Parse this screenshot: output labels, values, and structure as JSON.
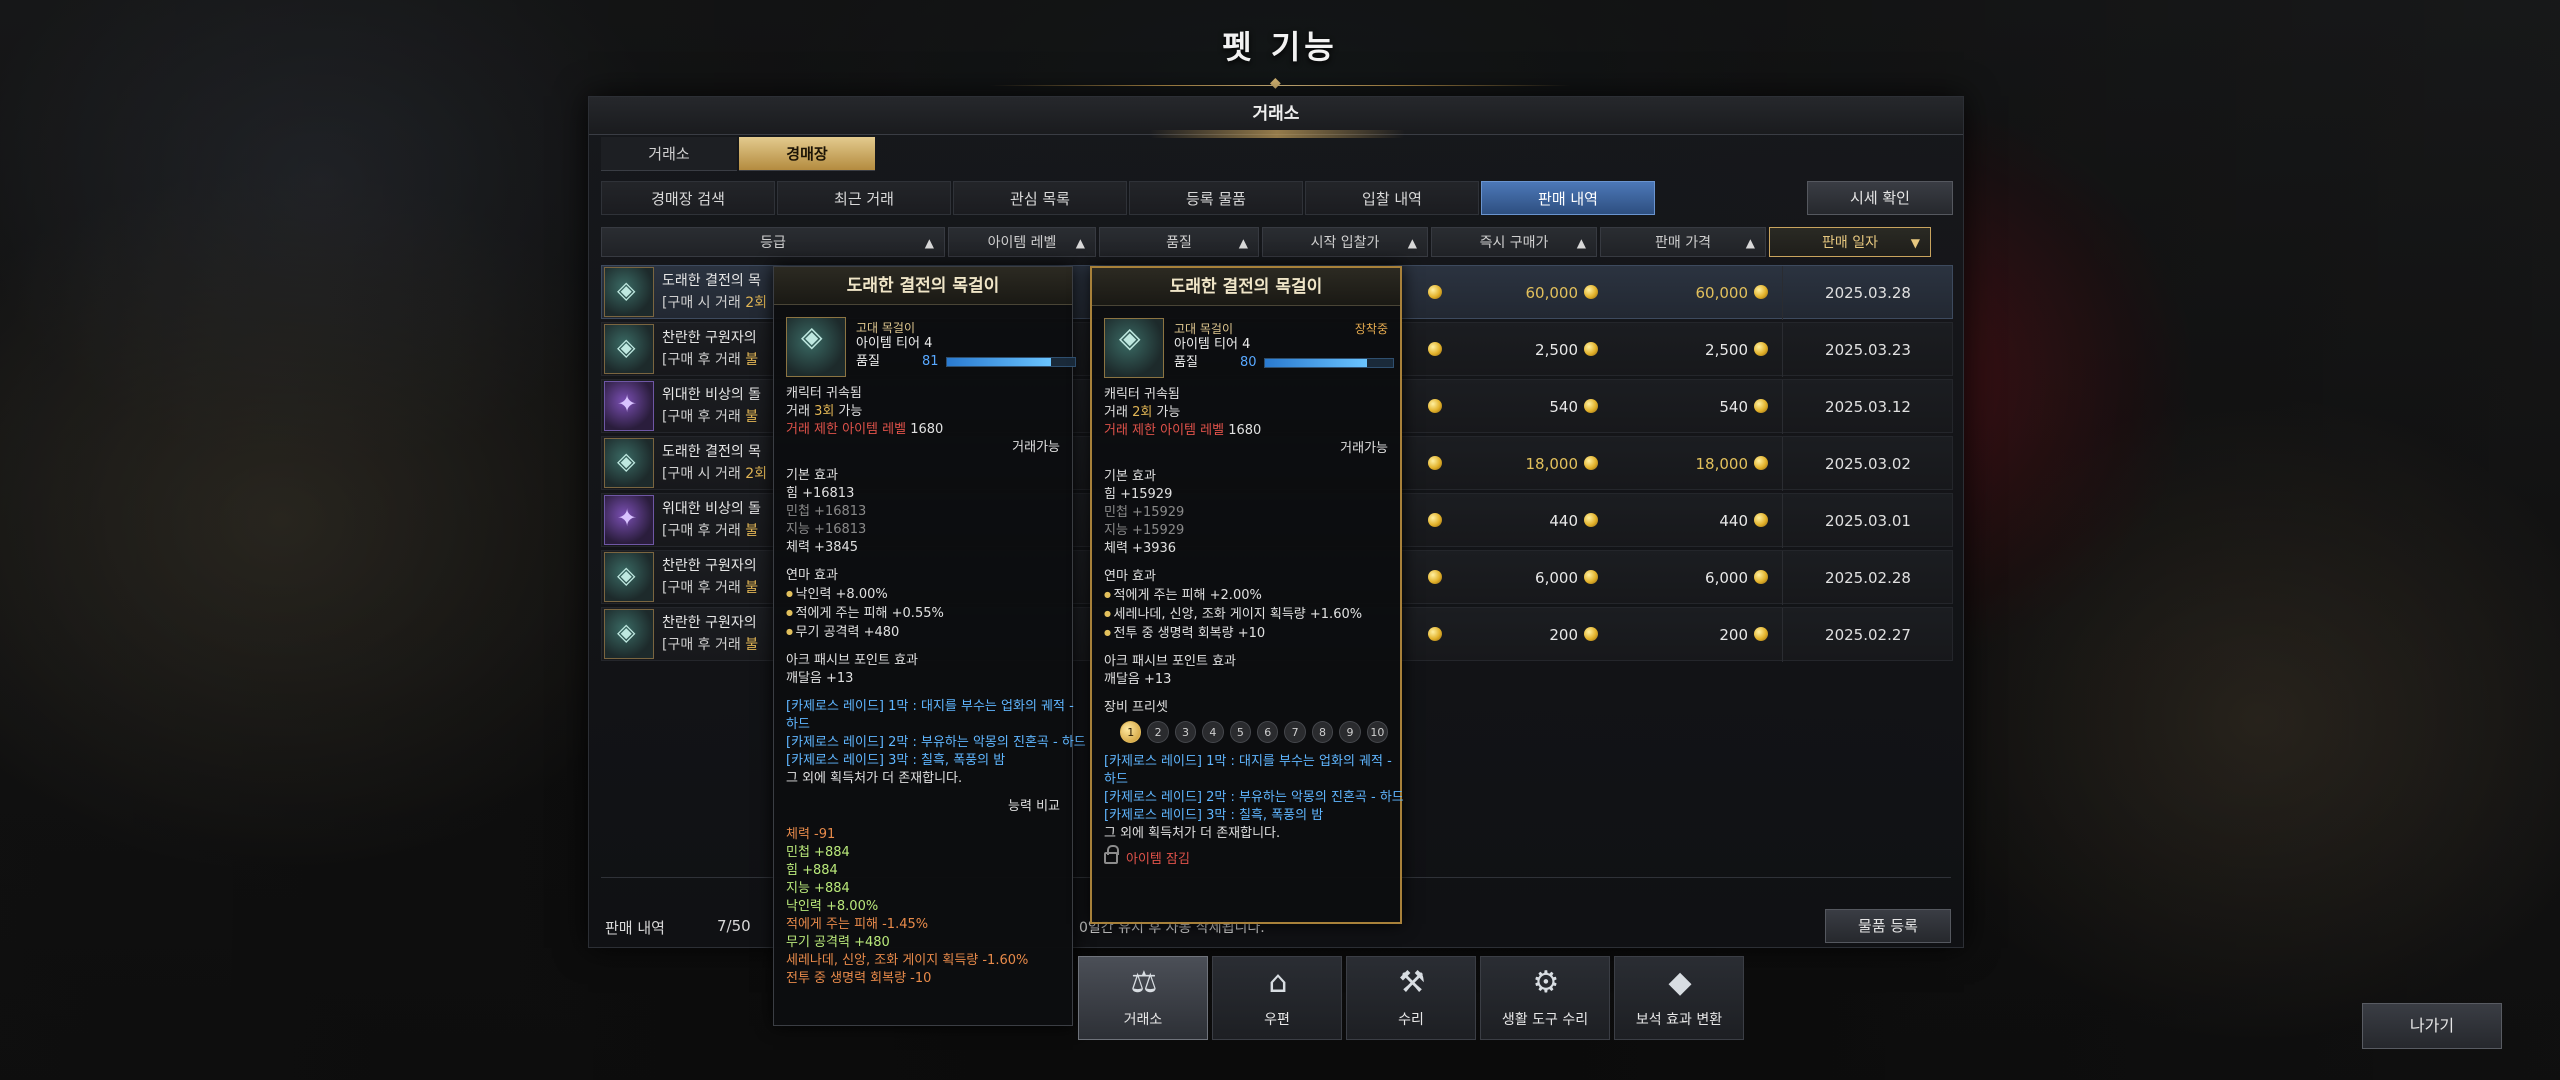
{
  "page": {
    "title": "펫 기능"
  },
  "window": {
    "title": "거래소"
  },
  "main_tabs": [
    {
      "label": "거래소",
      "active": false
    },
    {
      "label": "경매장",
      "active": true
    }
  ],
  "sub_tabs": [
    {
      "label": "경매장 검색",
      "active": false
    },
    {
      "label": "최근 거래",
      "active": false
    },
    {
      "label": "관심 목록",
      "active": false
    },
    {
      "label": "등록 물품",
      "active": false
    },
    {
      "label": "입찰 내역",
      "active": false
    },
    {
      "label": "판매 내역",
      "active": true
    }
  ],
  "market_price_button": "시세 확인",
  "sort_headers": [
    {
      "label": "등급",
      "arrow": "▲",
      "active": false
    },
    {
      "label": "아이템 레벨",
      "arrow": "▲",
      "active": false
    },
    {
      "label": "품질",
      "arrow": "▲",
      "active": false
    },
    {
      "label": "시작 입찰가",
      "arrow": "▲",
      "active": false
    },
    {
      "label": "즉시 구매가",
      "arrow": "▲",
      "active": false
    },
    {
      "label": "판매 가격",
      "arrow": "▲",
      "active": false
    },
    {
      "label": "판매 일자",
      "arrow": "▼",
      "active": true
    }
  ],
  "rows": [
    {
      "name": "도래한 결전의 목",
      "sub_prefix": "[구매 시 거래 ",
      "sub_count": "2회",
      "icon": "necklace-icon",
      "buy_now": "60,000",
      "sale_price": "60,000",
      "gold": true,
      "date": "2025.03.28",
      "selected": true
    },
    {
      "name": "찬란한 구원자의",
      "sub_prefix": "[구매 후 거래 ",
      "sub_count": "불",
      "icon": "stone-icon",
      "buy_now": "2,500",
      "sale_price": "2,500",
      "gold": false,
      "date": "2025.03.23",
      "selected": false
    },
    {
      "name": "위대한 비상의 돌",
      "sub_prefix": "[구매 후 거래 ",
      "sub_count": "불",
      "icon": "gem-icon",
      "buy_now": "540",
      "sale_price": "540",
      "gold": false,
      "date": "2025.03.12",
      "selected": false
    },
    {
      "name": "도래한 결전의 목",
      "sub_prefix": "[구매 시 거래 ",
      "sub_count": "2회",
      "icon": "necklace-icon",
      "buy_now": "18,000",
      "sale_price": "18,000",
      "gold": true,
      "date": "2025.03.02",
      "selected": false
    },
    {
      "name": "위대한 비상의 돌",
      "sub_prefix": "[구매 후 거래 ",
      "sub_count": "불",
      "icon": "gem-icon",
      "buy_now": "440",
      "sale_price": "440",
      "gold": false,
      "date": "2025.03.01",
      "selected": false
    },
    {
      "name": "찬란한 구원자의",
      "sub_prefix": "[구매 후 거래 ",
      "sub_count": "불",
      "icon": "stone-icon",
      "buy_now": "6,000",
      "sale_price": "6,000",
      "gold": false,
      "date": "2025.02.28",
      "selected": false
    },
    {
      "name": "찬란한 구원자의",
      "sub_prefix": "[구매 후 거래 ",
      "sub_count": "불",
      "icon": "stone-icon",
      "buy_now": "200",
      "sale_price": "200",
      "gold": false,
      "date": "2025.02.27",
      "selected": false
    }
  ],
  "footer": {
    "label": "판매 내역",
    "count": "7/50",
    "note": "0일간 유지 후 자동 삭제됩니다.",
    "register_button": "물품 등록"
  },
  "tooltip_left": {
    "title": "도래한 결전의 목걸이",
    "grade": "고대 목걸이",
    "tier": "아이템 티어 4",
    "quality_label": "품질",
    "quality_value": "81",
    "bound": "캐릭터 귀속됨",
    "trade_prefix": "거래 ",
    "trade_count": "3회",
    "trade_suffix": " 가능",
    "level_limit_label": "거래 제한 아이템 레벨",
    "level_limit_value": "1680",
    "tradeable": "거래가능",
    "base_header": "기본 효과",
    "base_stats": [
      {
        "text": "힘 +16813",
        "dim": false
      },
      {
        "text": "민첩 +16813",
        "dim": true
      },
      {
        "text": "지능 +16813",
        "dim": true
      },
      {
        "text": "체력 +3845",
        "dim": false
      }
    ],
    "enchant_header": "연마 효과",
    "enchant_stats": [
      "낙인력 +8.00%",
      "적에게 주는 피해 +0.55%",
      "무기 공격력 +480"
    ],
    "ark_header": "아크 패시브 포인트 효과",
    "ark_value": "깨달음 +13",
    "sources": [
      "[카제로스 레이드] 1막 : 대지를 부수는 업화의 궤적 -",
      "하드",
      "[카제로스 레이드] 2막 : 부유하는 악몽의 진혼곡 - 하드",
      "[카제로스 레이드] 3막 : 칠흑, 폭풍의 밤",
      "그 외에 획득처가 더 존재합니다."
    ],
    "compare_label": "능력 비교",
    "compare": [
      {
        "text": "체력 -91",
        "tone": "orange"
      },
      {
        "text": "민첩 +884",
        "tone": "green"
      },
      {
        "text": "힘 +884",
        "tone": "green"
      },
      {
        "text": "지능 +884",
        "tone": "green"
      },
      {
        "text": "낙인력 +8.00%",
        "tone": "green"
      },
      {
        "text": "적에게 주는 피해 -1.45%",
        "tone": "orange"
      },
      {
        "text": "무기 공격력 +480",
        "tone": "green"
      },
      {
        "text": "세레나데, 신앙, 조화 게이지 획득량 -1.60%",
        "tone": "orange"
      },
      {
        "text": "전투 중 생명력 회복량 -10",
        "tone": "orange"
      }
    ]
  },
  "tooltip_right": {
    "title": "도래한 결전의 목걸이",
    "grade": "고대 목걸이",
    "tier": "아이템 티어 4",
    "equipped": "장착중",
    "quality_label": "품질",
    "quality_value": "80",
    "bound": "캐릭터 귀속됨",
    "trade_prefix": "거래 ",
    "trade_count": "2회",
    "trade_suffix": " 가능",
    "level_limit_label": "거래 제한 아이템 레벨",
    "level_limit_value": "1680",
    "tradeable": "거래가능",
    "base_header": "기본 효과",
    "base_stats": [
      {
        "text": "힘 +15929",
        "dim": false
      },
      {
        "text": "민첩 +15929",
        "dim": true
      },
      {
        "text": "지능 +15929",
        "dim": true
      },
      {
        "text": "체력 +3936",
        "dim": false
      }
    ],
    "enchant_header": "연마 효과",
    "enchant_stats": [
      "적에게 주는 피해 +2.00%",
      "세레나데, 신앙, 조화 게이지 획득량 +1.60%",
      "전투 중 생명력 회복량 +10"
    ],
    "ark_header": "아크 패시브 포인트 효과",
    "ark_value": "깨달음 +13",
    "preset_header": "장비 프리셋",
    "presets": [
      "1",
      "2",
      "3",
      "4",
      "5",
      "6",
      "7",
      "8",
      "9",
      "10"
    ],
    "sources": [
      "[카제로스 레이드] 1막 : 대지를 부수는 업화의 궤적 -",
      "하드",
      "[카제로스 레이드] 2막 : 부유하는 악몽의 진혼곡 - 하드",
      "[카제로스 레이드] 3막 : 칠흑, 폭풍의 밤",
      "그 외에 획득처가 더 존재합니다."
    ],
    "lock_label": "아이템 잠김"
  },
  "dock": [
    {
      "label": "거래소",
      "icon": "gavel-icon",
      "glyph": "⚖",
      "active": true
    },
    {
      "label": "우편",
      "icon": "mailbox-icon",
      "glyph": "⌂",
      "active": false
    },
    {
      "label": "수리",
      "icon": "anvil-icon",
      "glyph": "⚒",
      "active": false
    },
    {
      "label": "생활 도구 수리",
      "icon": "tool-repair-icon",
      "glyph": "⚙",
      "active": false
    },
    {
      "label": "보석 효과 변환",
      "icon": "gem-convert-icon",
      "glyph": "◆",
      "active": false
    }
  ],
  "exit_button": "나가기",
  "colors": {
    "accent_gold": "#c9a45e",
    "active_tab_blue": "#4c78b8",
    "price_gold": "#e2c05c"
  }
}
